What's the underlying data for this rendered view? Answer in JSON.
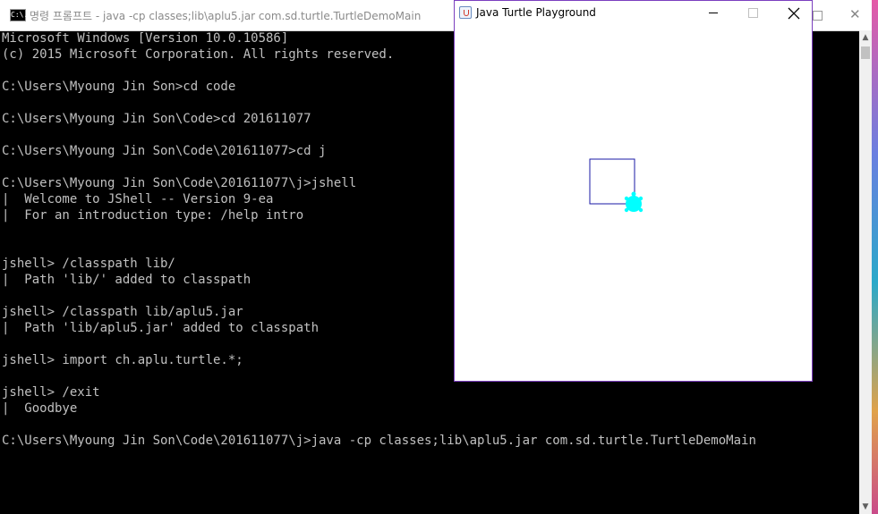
{
  "desktop": {
    "accent": "#e55aa7"
  },
  "cmd": {
    "icon_text": "C:\\.",
    "title": "명령 프롬프트 - java  -cp classes;lib\\aplu5.jar com.sd.turtle.TurtleDemoMain",
    "lines": [
      "Microsoft Windows [Version 10.0.10586]",
      "(c) 2015 Microsoft Corporation. All rights reserved.",
      "",
      "C:\\Users\\Myoung Jin Son>cd code",
      "",
      "C:\\Users\\Myoung Jin Son\\Code>cd 201611077",
      "",
      "C:\\Users\\Myoung Jin Son\\Code\\201611077>cd j",
      "",
      "C:\\Users\\Myoung Jin Son\\Code\\201611077\\j>jshell",
      "|  Welcome to JShell -- Version 9-ea",
      "|  For an introduction type: /help intro",
      "",
      "",
      "jshell> /classpath lib/",
      "|  Path 'lib/' added to classpath",
      "",
      "jshell> /classpath lib/aplu5.jar",
      "|  Path 'lib/aplu5.jar' added to classpath",
      "",
      "jshell> import ch.aplu.turtle.*;",
      "",
      "jshell> /exit",
      "|  Goodbye",
      "",
      "C:\\Users\\Myoung Jin Son\\Code\\201611077\\j>java -cp classes;lib\\aplu5.jar com.sd.turtle.TurtleDemoMain"
    ],
    "colors": {
      "background": "#000000",
      "text": "#c0c0c0"
    }
  },
  "turtle_window": {
    "title": "Java Turtle Playground",
    "colors": {
      "border": "#7b3fbf",
      "path": "#1a1aa6",
      "turtle": "#00ffff"
    }
  }
}
